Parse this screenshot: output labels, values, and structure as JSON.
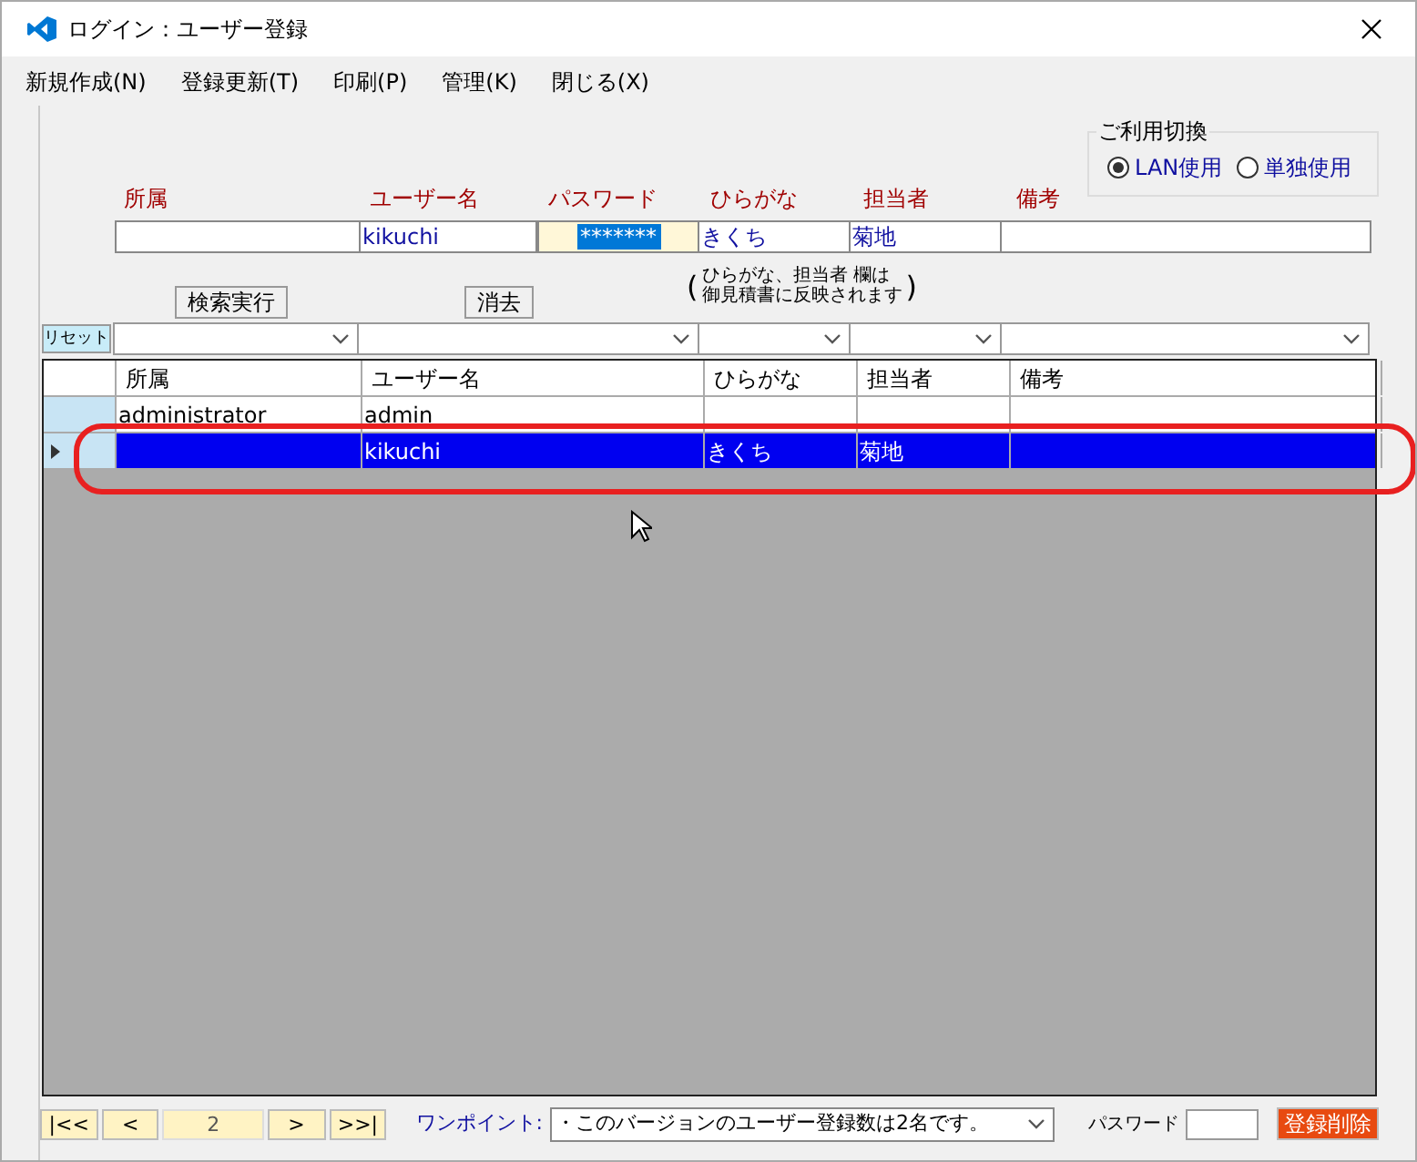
{
  "window": {
    "title": "ログイン：ユーザー登録"
  },
  "menu": [
    "新規作成(N)",
    "登録更新(T)",
    "印刷(P)",
    "管理(K)",
    "閉じる(X)"
  ],
  "usage_mode": {
    "title": "ご利用切換",
    "options": [
      {
        "label": "LAN使用",
        "selected": true
      },
      {
        "label": "単独使用",
        "selected": false
      }
    ]
  },
  "entry_form": {
    "fields": [
      {
        "label": "所属",
        "kind": "text"
      },
      {
        "label": "ユーザー名",
        "value": "kikuchi",
        "kind": "text"
      },
      {
        "label": "パスワード",
        "value": "*******",
        "kind": "password"
      },
      {
        "label": "ひらがな",
        "value": "きくち",
        "kind": "text"
      },
      {
        "label": "担当者",
        "value": "菊地",
        "kind": "text"
      },
      {
        "label": "備考",
        "kind": "text"
      }
    ],
    "note": {
      "open": "(",
      "lines": [
        "ひらがな、担当者 欄は",
        "御見積書に反映されます"
      ],
      "close": ")"
    }
  },
  "buttons": {
    "search": "検索実行",
    "clear": "消去",
    "reset": "リセット"
  },
  "filters": [
    {
      "kind": "dropdown"
    },
    {
      "kind": "dropdown"
    },
    {
      "kind": "dropdown"
    },
    {
      "kind": "dropdown"
    },
    {
      "kind": "dropdown"
    }
  ],
  "grid": {
    "columns": [
      "所属",
      "ユーザー名",
      "ひらがな",
      "担当者",
      "備考"
    ],
    "rows": [
      {
        "cells": [
          "administrator",
          "admin",
          null,
          null,
          null
        ],
        "selected": false
      },
      {
        "cells": [
          null,
          "kikuchi",
          "きくち",
          "菊地",
          null
        ],
        "selected": true
      }
    ]
  },
  "footer": {
    "nav": [
      "|<<",
      "<",
      ">",
      ">>|"
    ],
    "page": "2",
    "hint_label": "ワンポイント:",
    "hint": "・このバージョンのユーザー登録数は2名です。",
    "password_label": "パスワード",
    "delete": "登録削除"
  }
}
